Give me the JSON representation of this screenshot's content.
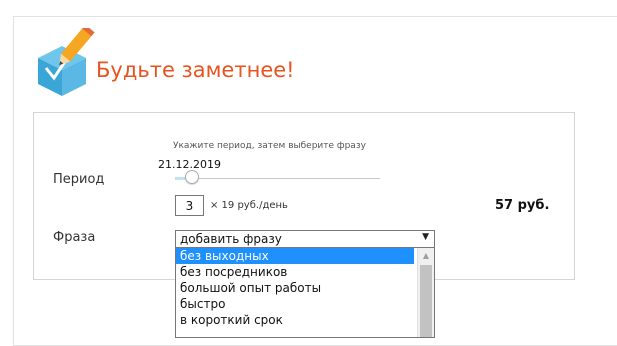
{
  "header": {
    "title": "Будьте заметнее!",
    "logo_icon": "pencil-checkmark-cube-icon"
  },
  "form": {
    "hint": "Укажите период, затем выберите фразу",
    "period": {
      "label": "Период",
      "date": "21.12.2019",
      "slider_level": 0.05
    },
    "days": {
      "value": "3",
      "rate_text": "× 19 руб./день"
    },
    "total": "57 руб.",
    "phrase": {
      "label": "Фраза",
      "select_value": "добавить фразу",
      "arrow": "▼",
      "options": [
        "без выходных",
        "без посредников",
        "большой опыт работы",
        "быстро",
        "в короткий срок"
      ],
      "selected_index": 0
    }
  },
  "colors": {
    "title": "#e8531f",
    "selected_option_bg": "#1e90ff",
    "slider_fill": "#bfe3f3"
  }
}
